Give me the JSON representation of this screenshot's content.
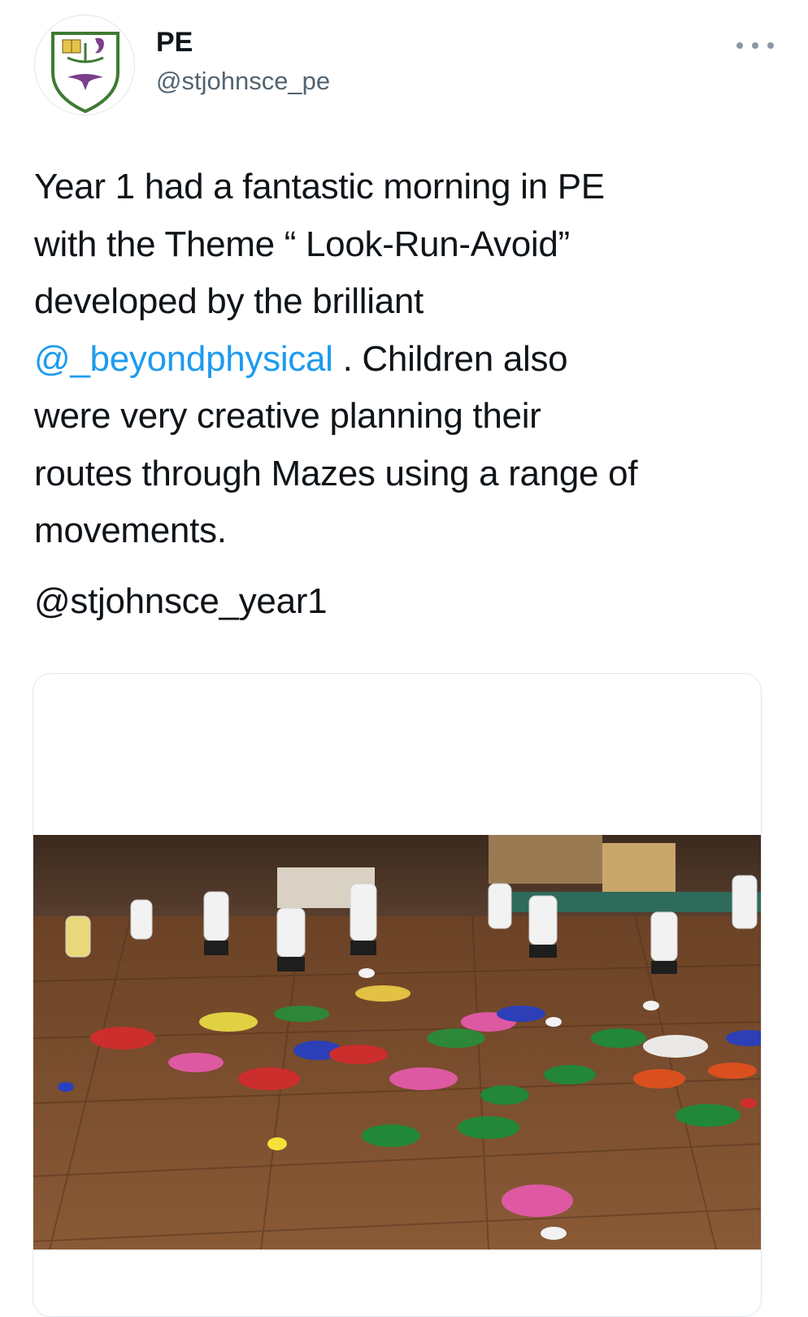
{
  "tweet": {
    "author": {
      "display_name": "PE",
      "handle": "@stjohnsce_pe",
      "avatar_icon": "school-crest-icon"
    },
    "more_icon": "more-options-icon",
    "body_lines": {
      "l1": "Year 1 had a fantastic morning in PE",
      "l2": "with the Theme “ Look-Run-Avoid”",
      "l3": "developed by the brilliant",
      "l4_mention": "@_beyondphysical",
      "l4_rest": " . Children also",
      "l5": "were very creative planning their",
      "l6": "routes through Mazes using a range of",
      "l7": "movements."
    },
    "cc_mention": "@stjohnsce_year1",
    "media": {
      "type": "video",
      "description_icon": "video-thumbnail"
    },
    "colors": {
      "link": "#1d9bf0",
      "text": "#0f1419",
      "secondary": "#536471"
    }
  }
}
